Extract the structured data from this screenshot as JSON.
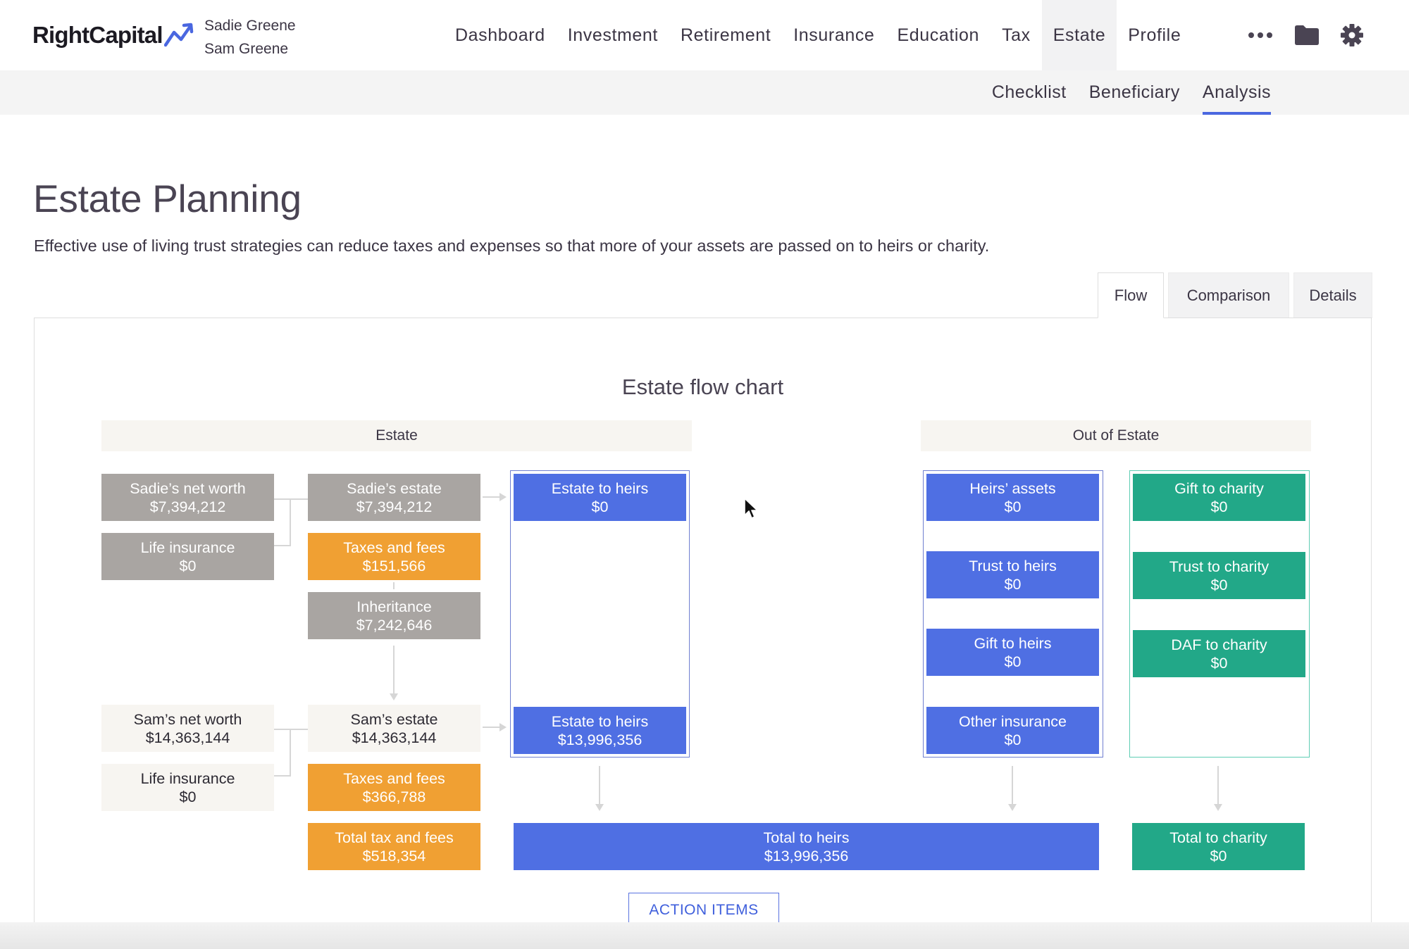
{
  "brand": {
    "name": "RightCapital"
  },
  "clients": [
    "Sadie Greene",
    "Sam Greene"
  ],
  "nav": {
    "items": [
      "Dashboard",
      "Investment",
      "Retirement",
      "Insurance",
      "Education",
      "Tax",
      "Estate",
      "Profile"
    ],
    "active": "Estate",
    "icons": [
      "more-dots-icon",
      "folder-icon",
      "gear-icon"
    ]
  },
  "subnav": {
    "items": [
      "Checklist",
      "Beneficiary",
      "Analysis"
    ],
    "active": "Analysis"
  },
  "page": {
    "title": "Estate Planning",
    "description": "Effective use of living trust strategies can reduce taxes and expenses so that more of your assets are passed on to heirs or charity."
  },
  "view_tabs": {
    "items": [
      "Flow",
      "Comparison",
      "Details"
    ],
    "active": "Flow"
  },
  "flow": {
    "title": "Estate flow chart",
    "estate_header": "Estate",
    "out_header": "Out of Estate",
    "sadie_net_worth": {
      "label": "Sadie’s net worth",
      "value": "$7,394,212"
    },
    "sadie_life_insurance": {
      "label": "Life insurance",
      "value": "$0"
    },
    "sadie_estate": {
      "label": "Sadie’s estate",
      "value": "$7,394,212"
    },
    "sadie_taxes": {
      "label": "Taxes and fees",
      "value": "$151,566"
    },
    "inheritance": {
      "label": "Inheritance",
      "value": "$7,242,646"
    },
    "sam_net_worth": {
      "label": "Sam’s net worth",
      "value": "$14,363,144"
    },
    "sam_life_insurance": {
      "label": "Life insurance",
      "value": "$0"
    },
    "sam_estate": {
      "label": "Sam’s estate",
      "value": "$14,363,144"
    },
    "sam_taxes": {
      "label": "Taxes and fees",
      "value": "$366,788"
    },
    "total_tax": {
      "label": "Total tax and fees",
      "value": "$518,354"
    },
    "estate_to_heirs_1": {
      "label": "Estate to heirs",
      "value": "$0"
    },
    "estate_to_heirs_2": {
      "label": "Estate to heirs",
      "value": "$13,996,356"
    },
    "heirs_assets": {
      "label": "Heirs’ assets",
      "value": "$0"
    },
    "trust_to_heirs": {
      "label": "Trust to heirs",
      "value": "$0"
    },
    "gift_to_heirs": {
      "label": "Gift to heirs",
      "value": "$0"
    },
    "other_insurance": {
      "label": "Other insurance",
      "value": "$0"
    },
    "gift_to_charity": {
      "label": "Gift to charity",
      "value": "$0"
    },
    "trust_to_charity": {
      "label": "Trust to charity",
      "value": "$0"
    },
    "daf_to_charity": {
      "label": "DAF to charity",
      "value": "$0"
    },
    "total_to_heirs": {
      "label": "Total to heirs",
      "value": "$13,996,356"
    },
    "total_to_charity": {
      "label": "Total to charity",
      "value": "$0"
    }
  },
  "action_button": "ACTION ITEMS",
  "colors": {
    "accent": "#4f6fe3",
    "gray_node": "#a9a5a2",
    "orange_node": "#f0a033",
    "green_node": "#22a888",
    "light_node": "#f7f5f1"
  }
}
